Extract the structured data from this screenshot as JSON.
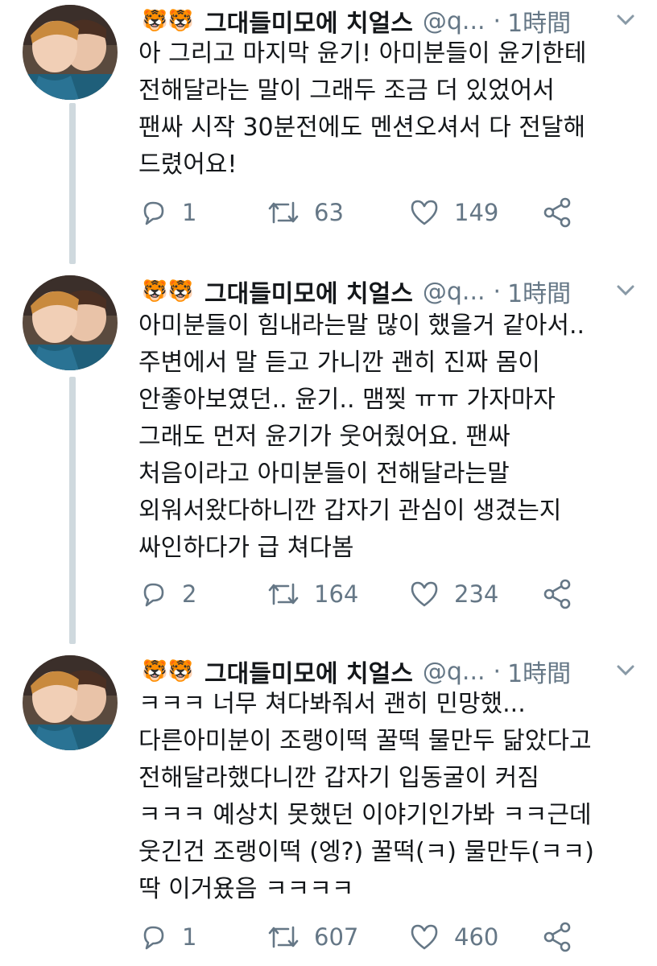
{
  "colors": {
    "text": "#14171a",
    "secondary": "#657786",
    "thread_line": "#cfd9de"
  },
  "tweets": [
    {
      "emoji": "🐯🐯",
      "name": "그대들미모에 치얼스",
      "handle": "@q...",
      "separator": "·",
      "time": "1時間",
      "lines": [
        "아 그리고 마지막 윤기! 아미분들이 윤기한테",
        "전해달라는 말이 그래두 조금 더 있었어서",
        "팬싸 시작 30분전에도 멘션오셔서 다 전달해",
        "드렸어요!"
      ],
      "replies": "1",
      "retweets": "63",
      "likes": "149"
    },
    {
      "emoji": "🐯🐯",
      "name": "그대들미모에 치얼스",
      "handle": "@q...",
      "separator": "·",
      "time": "1時間",
      "lines": [
        "아미분들이 힘내라는말 많이 했을거 같아서..",
        "주변에서 말 듣고 가니깐 괜히 진짜 몸이",
        "안좋아보였던.. 윤기.. 맴찢 ㅠㅠ 가자마자",
        "그래도 먼저 윤기가 웃어줬어요. 팬싸",
        "처음이라고 아미분들이 전해달라는말",
        "외워서왔다하니깐 갑자기 관심이 생겼는지",
        "싸인하다가 급 쳐다봄"
      ],
      "replies": "2",
      "retweets": "164",
      "likes": "234"
    },
    {
      "emoji": "🐯🐯",
      "name": "그대들미모에 치얼스",
      "handle": "@q...",
      "separator": "·",
      "time": "1時間",
      "lines": [
        "ㅋㅋㅋ 너무 쳐다봐줘서 괜히 민망했...",
        "다른아미분이 조랭이떡 꿀떡 물만두 닮았다고",
        "전해달라했다니깐 갑자기 입동굴이 커짐",
        "ㅋㅋㅋ 예상치 못했던 이야기인가봐 ㅋㅋ근데",
        "웃긴건 조랭이떡 (엥?) 꿀떡(ㅋ) 물만두(ㅋㅋ)",
        "딱 이거욨음 ㅋㅋㅋㅋ"
      ],
      "replies": "1",
      "retweets": "607",
      "likes": "460"
    }
  ]
}
